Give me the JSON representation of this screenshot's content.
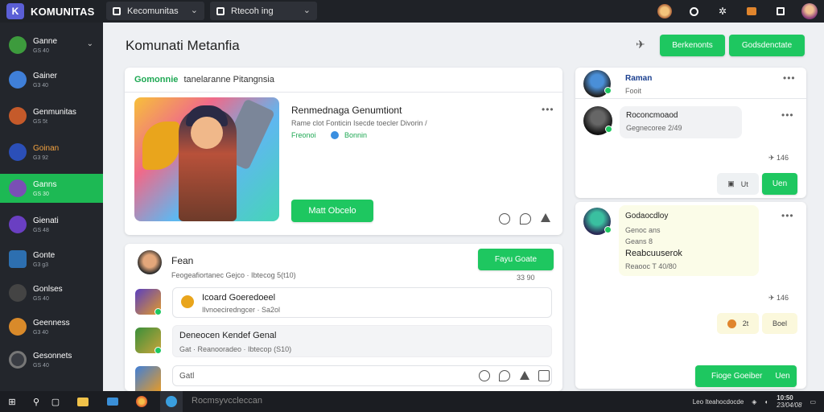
{
  "app": {
    "brand": "KOMUNITAS"
  },
  "topbar": {
    "dropdown1": "Kecomunitas",
    "dropdown2": "Rtecoh ing"
  },
  "sidebar": {
    "items": [
      {
        "name": "Ganne",
        "sub": "GS 40"
      },
      {
        "name": "Gainer",
        "sub": "G3 40"
      },
      {
        "name": "Genmunitas",
        "sub": "GS 5t"
      },
      {
        "name": "Goinan",
        "sub": "G3 92"
      },
      {
        "name": "Ganns",
        "sub": "GS 30"
      },
      {
        "name": "Gienati",
        "sub": "GS 48"
      },
      {
        "name": "Gonte",
        "sub": "G3 g3"
      },
      {
        "name": "Gonlses",
        "sub": "GS 40"
      },
      {
        "name": "Geenness",
        "sub": "G3 40"
      },
      {
        "name": "Gesonnets",
        "sub": "GS 40"
      }
    ]
  },
  "header": {
    "title": "Komunati Metanfia",
    "button1": "Berkenonts",
    "button2": "Godsdenctate"
  },
  "feature": {
    "head_green": "Gomonnie",
    "head_text": "tanelaranne Pitangnsia",
    "post_title": "Renmednaga Genumtiont",
    "post_desc": "Rame clot Fonticin Isecde toecler Divorin /",
    "tag": "Freonoi",
    "tag2": "Bonnin",
    "cta": "Matt Obcelo"
  },
  "thread": {
    "author": "Fean",
    "meta": "Feogeafiortanec Gejco · Ibtecog 5(t10)",
    "action": "Fayu Goate",
    "count": "33 90",
    "reply1_title": "Icoard Goeredoeel",
    "reply1_meta": "Ilvnoeciredngcer · Sa2ol",
    "reply2_title": "Deneocen Kendef Genal",
    "reply2_meta": "Gat · Reanooradeo · Ibtecop (S10)",
    "input_placeholder": "Gatl"
  },
  "right_panel": {
    "user1": {
      "name": "Raman",
      "sub": "Fooit"
    },
    "message1": {
      "title": "Roconcmoaod",
      "sub": "Gegnecoree 2/49"
    },
    "count1": "146",
    "chip1": "Ut",
    "reply_btn1": "Uen",
    "message2": {
      "l1": "Godaocdloy",
      "l2": "Genoc ans",
      "l3": "Geans 8",
      "l4": "Reabcuuserok",
      "l5": "Reaooc T 40/80"
    },
    "count2": "146",
    "chip2": "2t",
    "reply_btn2": "Boel",
    "bottom_action": "Fioge Goeiber",
    "bottom_btn": "Uen"
  },
  "taskbar": {
    "search": "Rocmsyvccleccan",
    "right1": "Leo Iteahocdocde",
    "clock": "10:50",
    "date": "23/04/08"
  }
}
